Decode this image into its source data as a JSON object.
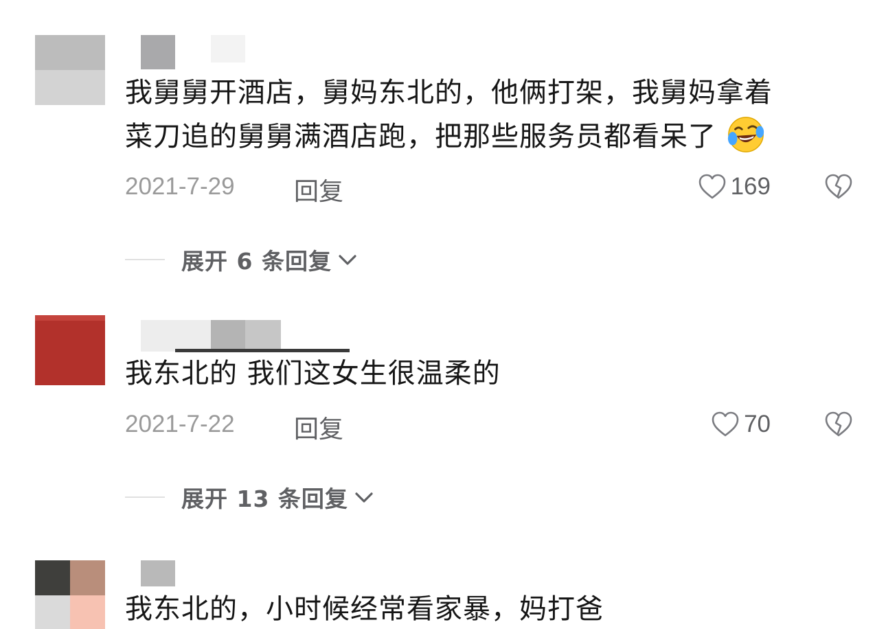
{
  "comments": [
    {
      "text_line1": "我舅舅开酒店，舅妈东北的，他俩打架，我舅妈拿着",
      "text_line2": "菜刀追的舅舅满酒店跑，把那些服务员都看呆了",
      "emoji": "laughing-crying-emoji",
      "date": "2021-7-29",
      "reply_label": "回复",
      "like_count": "169",
      "expand_label": "展开 6 条回复"
    },
    {
      "text_line1": "我东北的 我们这女生很温柔的",
      "date": "2021-7-22",
      "reply_label": "回复",
      "like_count": "70",
      "expand_label": "展开 13 条回复"
    },
    {
      "text_line1": "我东北的，小时候经常看家暴，妈打爸"
    }
  ],
  "icons": {
    "like": "heart-outline-icon",
    "dislike": "broken-heart-icon",
    "expand": "chevron-down-icon"
  },
  "colors": {
    "text": "#161616",
    "meta_gray": "#9a9a9a",
    "action_gray": "#5f6063",
    "avatar2_red": "#b2312b"
  }
}
